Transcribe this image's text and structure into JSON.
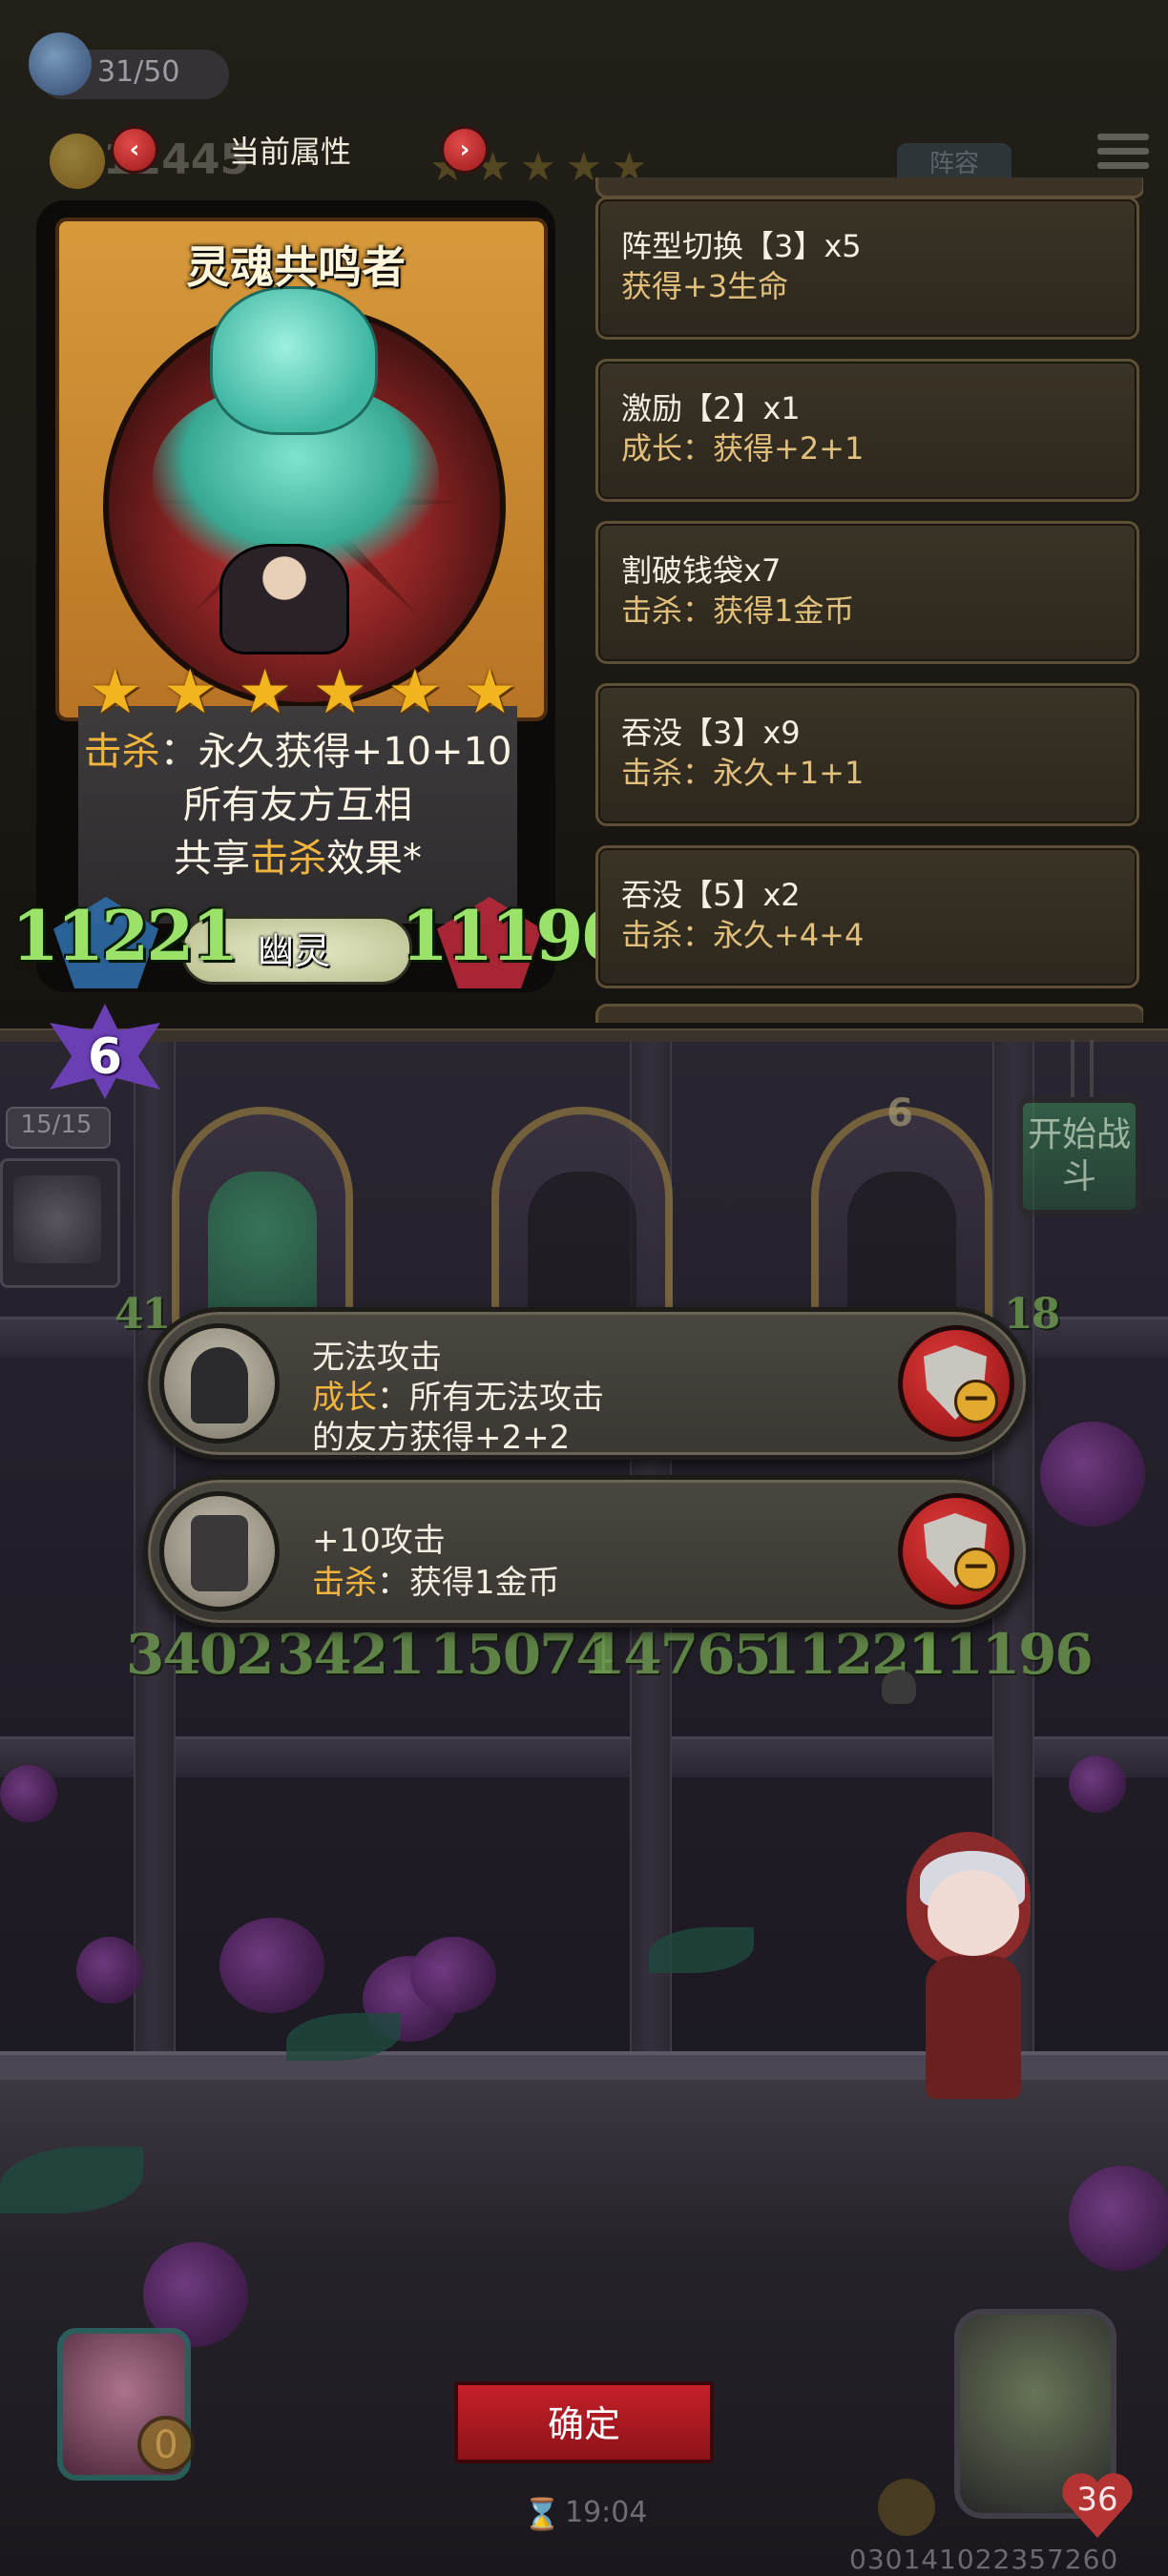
{
  "hud": {
    "population": "31/50",
    "gold": "12445",
    "ghost_tab": "阵容"
  },
  "panel": {
    "title": "当前属性",
    "prev_icon": "chevron-left-icon",
    "next_icon": "chevron-right-icon"
  },
  "card": {
    "name": "灵魂共鸣者",
    "stars": 6,
    "desc_line1_kw": "击杀",
    "desc_line1_rest": "：永久获得+10+10",
    "desc_line2": "所有友方互相",
    "desc_line3_pre": "共享",
    "desc_line3_kw": "击杀",
    "desc_line3_post": "效果*",
    "attack": "11221",
    "health": "11196",
    "type": "幽灵"
  },
  "attributes": [
    {
      "name": "阵型切换【3】x5",
      "effect": "获得+3生命"
    },
    {
      "name": "激励【2】x1",
      "effect": "成长：获得+2+1"
    },
    {
      "name": "割破钱袋x7",
      "effect": "击杀：获得1金币"
    },
    {
      "name": "吞没【3】x9",
      "effect": "击杀：永久+1+1"
    },
    {
      "name": "吞没【5】x2",
      "effect": "击杀：永久+4+4"
    }
  ],
  "board": {
    "level": "6",
    "hand_count": "15/15",
    "slot3_level": "6",
    "start_battle": "开始战斗",
    "under_stats": [
      "3402",
      "3421",
      "15074",
      "14765",
      "11221",
      "11196"
    ],
    "left_partial": "41",
    "right_partial": "18"
  },
  "popups": [
    {
      "title": "无法攻击",
      "line1_kw": "成长",
      "line1_rest": "：所有无法攻击",
      "line2": "的友方获得+2+2",
      "icon": "hooded-figure-icon"
    },
    {
      "title": "+10攻击",
      "line1_kw": "击杀",
      "line1_rest": "：获得1金币",
      "line2": "",
      "icon": "gauntlet-icon"
    }
  ],
  "bottom": {
    "confirm": "确定",
    "timer": "19:04",
    "build_id": "030141022357260",
    "left_coin": "0",
    "heart_count": "36"
  },
  "colors": {
    "keyword": "#f1b43d",
    "stat_green": "#9be26b",
    "confirm_red": "#c6202a",
    "star_gold": "#f3b51e"
  }
}
